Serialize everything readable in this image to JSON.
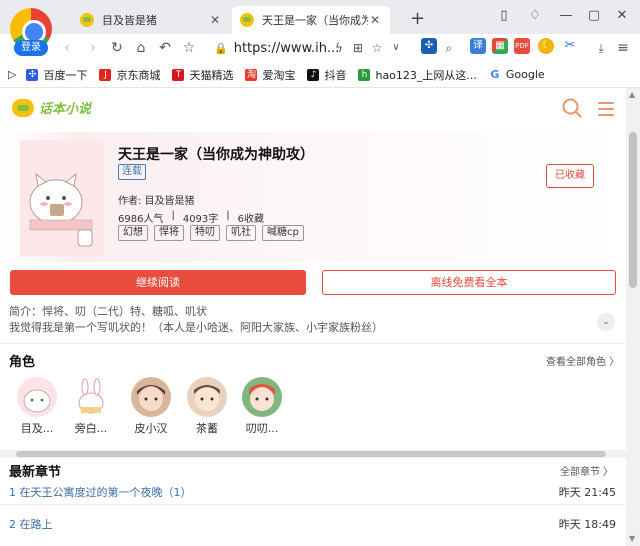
{
  "browser": {
    "login_label": "登录",
    "tabs": [
      {
        "label": "目及皆是猪",
        "close": "✕"
      },
      {
        "label": "天王是一家（当你成为神助",
        "close": "✕"
      }
    ],
    "new_tab": "+",
    "url": "https://www.ih...",
    "bookmarks": [
      "百度一下",
      "京东商城",
      "天猫精选",
      "爱淘宝",
      "抖音",
      "hao123_上网从这...",
      "Google"
    ],
    "colors": {
      "tabbar": "#e9ebee",
      "accent_blue": "#1a73e8"
    }
  },
  "site": {
    "logo_text": "话本小说",
    "colors": {
      "primary_red": "#e94b3c",
      "logo_green": "#7cc142",
      "logo_yellow": "#f4c20d",
      "link_blue": "#3a6fa8",
      "header_icon": "#e8956a"
    }
  },
  "book": {
    "title": "天王是一家（当你成为神助攻）",
    "status": "连载",
    "author": "作者: 目及皆是猪",
    "popularity": "6986人气",
    "words": "4093字",
    "collections": "6收藏",
    "tags": [
      "幻想",
      "悍将",
      "特叨",
      "叽社",
      "喊糖cp"
    ],
    "collected_label": "已收藏",
    "continue_label": "继续阅读",
    "offline_label": "离线免费看全本",
    "intro_line1": "简介：悍将、叨（二代）特、糖呱、叽状",
    "intro_line2": "我觉得我是第一个写叽状的！（本人是小哈迷、阿阳大家族、小宇家族粉丝）"
  },
  "characters": {
    "title": "角色",
    "more_label": "查看全部角色 〉",
    "items": [
      {
        "name": "目及..."
      },
      {
        "name": "旁白..."
      },
      {
        "name": "皮小汉"
      },
      {
        "name": "茶蓄"
      },
      {
        "name": "叨叨..."
      }
    ]
  },
  "chapters": {
    "title": "最新章节",
    "more_label": "全部章节 〉",
    "items": [
      {
        "title": "1 在天王公寓度过的第一个夜晚（1）",
        "time": "昨天 21:45"
      },
      {
        "title": "2 在路上",
        "time": "昨天 18:49"
      }
    ]
  }
}
